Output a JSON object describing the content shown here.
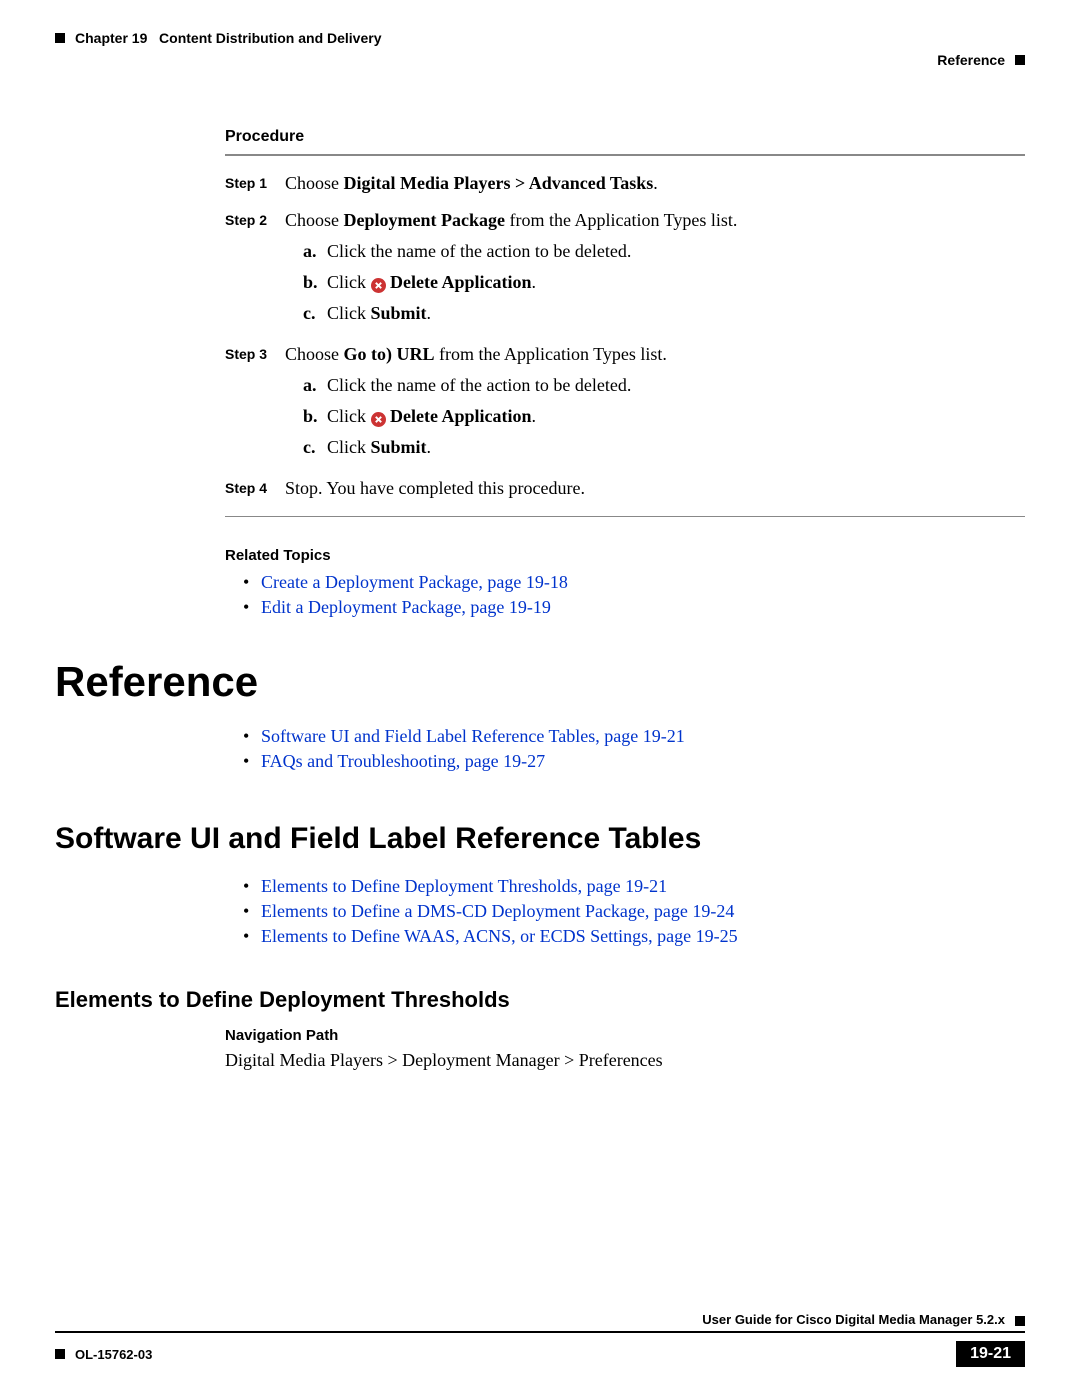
{
  "header": {
    "chapter_label": "Chapter 19",
    "chapter_title": "Content Distribution and Delivery",
    "section": "Reference"
  },
  "procedure": {
    "heading": "Procedure",
    "steps": [
      {
        "label": "Step 1",
        "prefix": "Choose ",
        "bold": "Digital Media Players > Advanced Tasks",
        "suffix": ".",
        "sub": []
      },
      {
        "label": "Step 2",
        "prefix": "Choose ",
        "bold": "Deployment Package",
        "suffix": " from the Application Types list.",
        "sub": [
          {
            "m": "a.",
            "text": "Click the name of the action to be deleted."
          },
          {
            "m": "b.",
            "text_pre": "Click ",
            "icon": true,
            "text_bold": " Delete Application",
            "text_post": "."
          },
          {
            "m": "c.",
            "text_pre": "Click ",
            "text_bold": "Submit",
            "text_post": "."
          }
        ]
      },
      {
        "label": "Step 3",
        "prefix": "Choose ",
        "bold": "Go to) URL",
        "suffix": " from the Application Types list.",
        "sub": [
          {
            "m": "a.",
            "text": "Click the name of the action to be deleted."
          },
          {
            "m": "b.",
            "text_pre": "Click ",
            "icon": true,
            "text_bold": " Delete Application",
            "text_post": "."
          },
          {
            "m": "c.",
            "text_pre": "Click ",
            "text_bold": "Submit",
            "text_post": "."
          }
        ]
      },
      {
        "label": "Step 4",
        "prefix": "Stop. You have completed this procedure.",
        "bold": "",
        "suffix": "",
        "sub": []
      }
    ]
  },
  "related": {
    "heading": "Related Topics",
    "links": [
      "Create a Deployment Package, page 19-18",
      "Edit a Deployment Package, page 19-19"
    ]
  },
  "h1": "Reference",
  "ref_links": [
    "Software UI and Field Label Reference Tables, page 19-21",
    "FAQs and Troubleshooting, page 19-27"
  ],
  "h2": "Software UI and Field Label Reference Tables",
  "ui_links": [
    "Elements to Define Deployment Thresholds, page 19-21",
    "Elements to Define a DMS-CD Deployment Package, page 19-24",
    "Elements to Define WAAS, ACNS, or ECDS Settings, page 19-25"
  ],
  "h3": "Elements to Define Deployment Thresholds",
  "nav": {
    "heading": "Navigation Path",
    "path": "Digital Media Players > Deployment Manager > Preferences"
  },
  "footer": {
    "guide": "User Guide for Cisco Digital Media Manager 5.2.x",
    "doc": "OL-15762-03",
    "page": "19-21"
  }
}
